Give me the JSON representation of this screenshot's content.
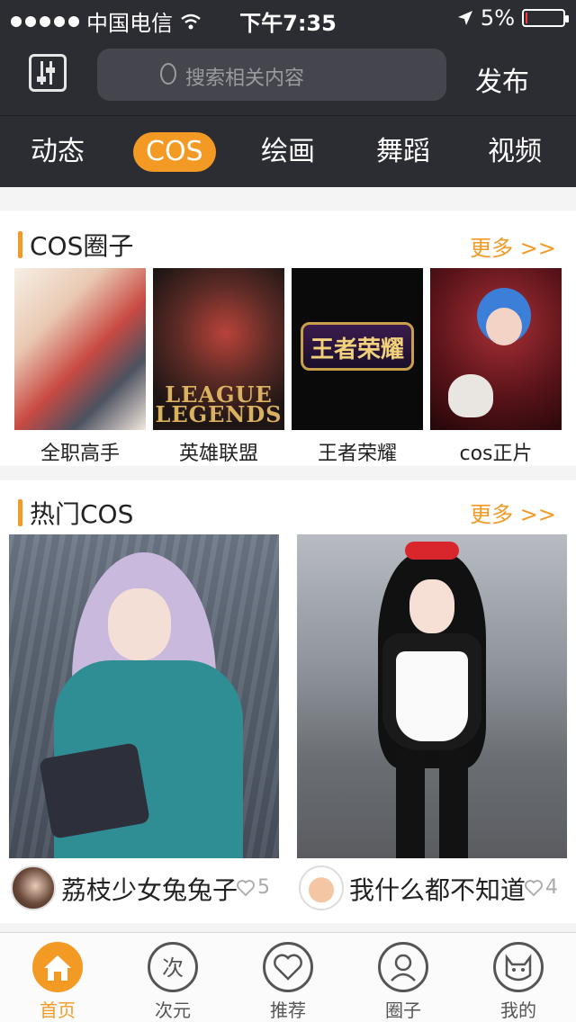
{
  "status_bar": {
    "carrier": "中国电信",
    "time": "下午7:35",
    "battery_percent": "5%",
    "battery_level": 0.05
  },
  "header": {
    "search_placeholder": "搜索相关内容",
    "publish_label": "发布"
  },
  "category_tabs": {
    "items": [
      {
        "label": "动态"
      },
      {
        "label": "COS"
      },
      {
        "label": "绘画"
      },
      {
        "label": "舞蹈"
      },
      {
        "label": "视频"
      }
    ],
    "active": "COS"
  },
  "cos_circles": {
    "title": "COS圈子",
    "more_label": "更多 >>",
    "items": [
      {
        "name": "全职高手"
      },
      {
        "name": "英雄联盟",
        "image_text": "LEAGUE LEGENDS"
      },
      {
        "name": "王者荣耀",
        "image_text": "王者荣耀"
      },
      {
        "name": "cos正片"
      }
    ]
  },
  "hot_cos": {
    "title": "热门COS",
    "more_label": "更多 >>",
    "posts": [
      {
        "user": "荔枝少女兔兔子",
        "likes": "5"
      },
      {
        "user": "我什么都不知道",
        "likes": "4"
      }
    ]
  },
  "bottom_tabs": {
    "items": [
      {
        "label": "首页",
        "icon": "home-icon"
      },
      {
        "label": "次元",
        "icon": "dimension-icon"
      },
      {
        "label": "推荐",
        "icon": "heart-icon"
      },
      {
        "label": "圈子",
        "icon": "circle-icon"
      },
      {
        "label": "我的",
        "icon": "profile-icon"
      }
    ],
    "active": "首页"
  },
  "colors": {
    "accent": "#f39a25",
    "header_bg": "#2c2d33",
    "battery_low": "#ff3b30"
  }
}
